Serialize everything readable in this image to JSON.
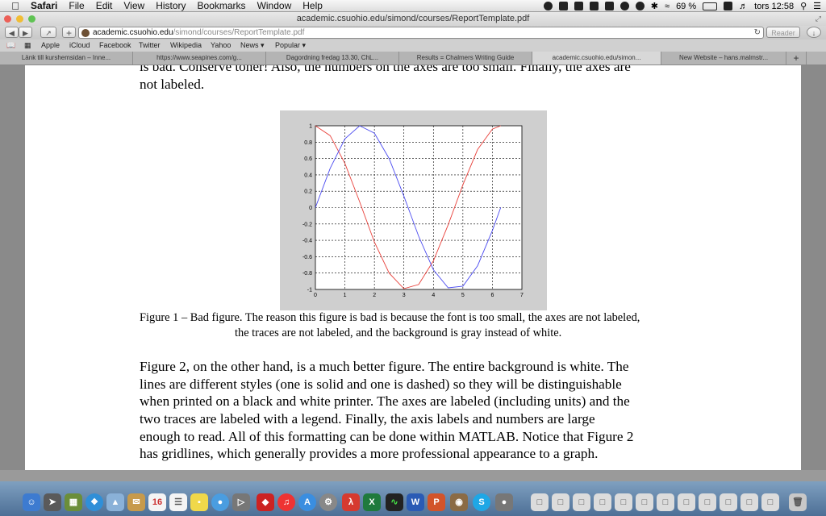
{
  "menubar": {
    "app": "Safari",
    "items": [
      "File",
      "Edit",
      "View",
      "History",
      "Bookmarks",
      "Window",
      "Help"
    ],
    "battery": "69 %",
    "clock": "tors 12:58"
  },
  "window": {
    "title": "academic.csuohio.edu/simond/courses/ReportTemplate.pdf",
    "url_host": "academic.csuohio.edu",
    "url_path": "/simond/courses/ReportTemplate.pdf",
    "reader_label": "Reader"
  },
  "bookmarks": [
    "Apple",
    "iCloud",
    "Facebook",
    "Twitter",
    "Wikipedia",
    "Yahoo",
    "News ▾",
    "Popular ▾"
  ],
  "tabs": [
    "Länk till kurshemsidan – Inne...",
    "https://www.seapines.com/g...",
    "Dagordning fredag 13.30, ChL...",
    "Results = Chalmers Writing Guide",
    "academic.csuohio.edu/simon...",
    "New Website – hans.malmstr..."
  ],
  "document": {
    "top_line1": "is bad. Conserve toner! Also, the numbers on the axes are too small. Finally, the axes are",
    "top_line2": "not labeled.",
    "caption_line1": "Figure 1 – Bad figure. The reason this figure is bad is because the font is too small, the axes are not labeled,",
    "caption_line2": "the traces are not labeled, and the background is gray instead of white.",
    "para_lines": [
      "Figure 2, on the other hand, is a much better figure. The entire background is white. The",
      "lines are different styles (one is solid and one is dashed) so they will be distinguishable",
      "when printed on a black and white printer. The axes are labeled (including units) and the",
      "two traces are labeled with a legend. Finally, the axis labels and numbers are large",
      "enough to read. All of this formatting can be done within MATLAB. Notice that Figure 2",
      "has gridlines, which generally provides a more professional appearance to a graph."
    ]
  },
  "dock": {
    "calendar_day": "16"
  },
  "colors": {
    "series_red": "#e8403a",
    "series_blue": "#4b4bf0",
    "figure_background": "#cfcfcf"
  },
  "chart_data": {
    "type": "line",
    "title": "",
    "xlabel": "",
    "ylabel": "",
    "xlim": [
      0,
      7
    ],
    "ylim": [
      -1,
      1
    ],
    "xticks": [
      "0",
      "1",
      "2",
      "3",
      "4",
      "5",
      "6",
      "7"
    ],
    "yticks": [
      "1",
      "0.8",
      "0.6",
      "0.4",
      "0.2",
      "0",
      "-0.2",
      "-0.4",
      "-0.6",
      "-0.8",
      "-1"
    ],
    "grid": true,
    "legend": "none",
    "series": [
      {
        "color": "red",
        "x": [
          0,
          0.5,
          1,
          1.5,
          2,
          2.5,
          3,
          3.5,
          4,
          4.5,
          5,
          5.5,
          6,
          6.28
        ],
        "y": [
          1,
          0.88,
          0.54,
          0.07,
          -0.42,
          -0.8,
          -0.99,
          -0.94,
          -0.65,
          -0.21,
          0.28,
          0.71,
          0.96,
          1
        ]
      },
      {
        "color": "blue",
        "x": [
          0,
          0.5,
          1,
          1.5,
          2,
          2.5,
          3,
          3.5,
          4,
          4.5,
          5,
          5.5,
          6,
          6.28
        ],
        "y": [
          0,
          0.48,
          0.84,
          1,
          0.91,
          0.6,
          0.14,
          -0.35,
          -0.76,
          -0.98,
          -0.96,
          -0.71,
          -0.28,
          0
        ]
      }
    ]
  }
}
